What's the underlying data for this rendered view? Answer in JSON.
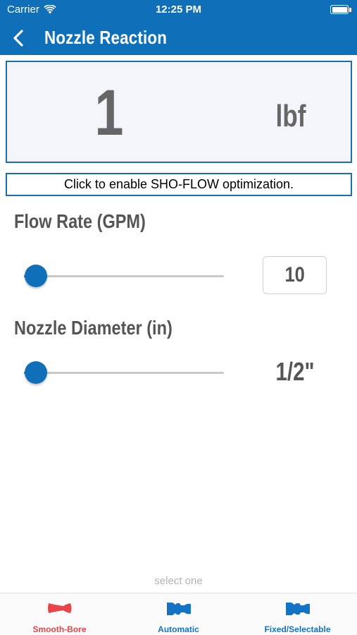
{
  "status_bar": {
    "carrier": "Carrier",
    "time": "12:25 PM"
  },
  "nav": {
    "title": "Nozzle Reaction"
  },
  "result": {
    "value": "1",
    "unit": "lbf"
  },
  "optimization_banner": "Click to enable SHO-FLOW optimization.",
  "flow_rate": {
    "label": "Flow Rate (GPM)",
    "value": "10",
    "slider_fraction": 0.06
  },
  "nozzle_diameter": {
    "label": "Nozzle Diameter (in)",
    "value": "1/2\"",
    "slider_fraction": 0.06
  },
  "footer": {
    "hint": "select one",
    "tabs": [
      {
        "label": "Smooth-Bore",
        "icon": "nozzle-icon",
        "color": "#e8454a"
      },
      {
        "label": "Automatic",
        "icon": "nozzle-icon",
        "color": "#1373c4"
      },
      {
        "label": "Fixed/Selectable",
        "icon": "nozzle-icon",
        "color": "#1373c4"
      }
    ]
  },
  "colors": {
    "brand": "#0f6fb8",
    "selected_tab": "#e8454a"
  }
}
